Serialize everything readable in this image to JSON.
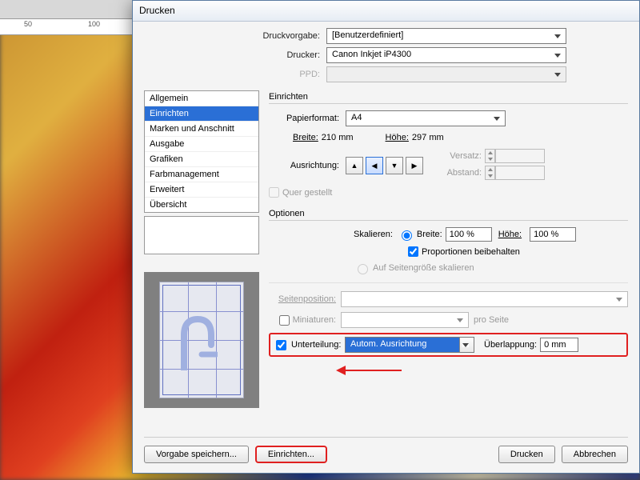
{
  "ruler": {
    "t50": "50",
    "t100": "100"
  },
  "dialog": {
    "title": "Drucken"
  },
  "presets": {
    "preset_label": "Druckvorgabe:",
    "preset_value": "[Benutzerdefiniert]",
    "printer_label": "Drucker:",
    "printer_value": "Canon Inkjet iP4300",
    "ppd_label": "PPD:",
    "ppd_value": ""
  },
  "categories": [
    "Allgemein",
    "Einrichten",
    "Marken und Anschnitt",
    "Ausgabe",
    "Grafiken",
    "Farbmanagement",
    "Erweitert",
    "Übersicht"
  ],
  "setup": {
    "section": "Einrichten",
    "paperformat_label": "Papierformat:",
    "paperformat_value": "A4",
    "width_label": "Breite:",
    "width_value": "210 mm",
    "height_label": "Höhe:",
    "height_value": "297 mm",
    "orientation_label": "Ausrichtung:",
    "offset_label": "Versatz:",
    "offset_value": "",
    "gap_label": "Abstand:",
    "gap_value": "",
    "quer_label": "Quer gestellt"
  },
  "options": {
    "section": "Optionen",
    "scale_label": "Skalieren:",
    "radio_width": "Breite:",
    "width_pct": "100 %",
    "height_lbl": "Höhe:",
    "height_pct": "100 %",
    "prop_label": "Proportionen beibehalten",
    "fit_label": "Auf Seitengröße skalieren",
    "pagepos_label": "Seitenposition:",
    "pagepos_value": "",
    "thumb_label": "Miniaturen:",
    "thumb_value": "",
    "thumb_suffix": "pro Seite",
    "tile_label": "Unterteilung:",
    "tile_value": "Autom. Ausrichtung",
    "overlap_label": "Überlappung:",
    "overlap_value": "0 mm"
  },
  "buttons": {
    "save_preset": "Vorgabe speichern...",
    "setup": "Einrichten...",
    "print": "Drucken",
    "cancel": "Abbrechen"
  }
}
